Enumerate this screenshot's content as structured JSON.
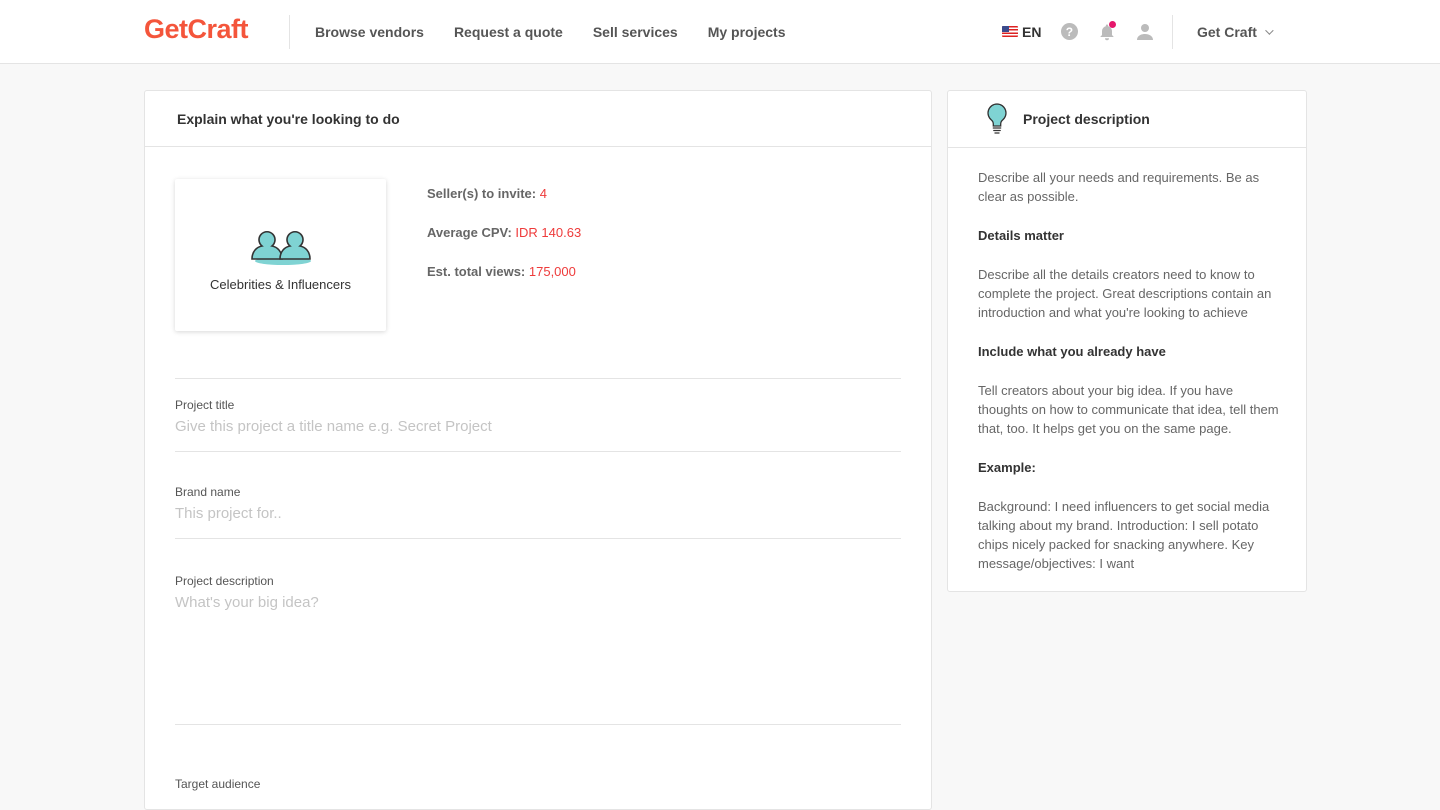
{
  "nav": {
    "logo": "GetCraft",
    "links": [
      "Browse vendors",
      "Request a quote",
      "Sell services",
      "My projects"
    ],
    "language": "EN",
    "account_label": "Get Craft",
    "notification_dot_color": "#e5176b"
  },
  "main": {
    "header": "Explain what you're looking to do",
    "category": "Celebrities & Influencers",
    "stats": [
      {
        "label": "Seller(s) to invite:",
        "value": "4"
      },
      {
        "label": "Average CPV:",
        "value": "IDR 140.63"
      },
      {
        "label": "Est. total views:",
        "value": "175,000"
      }
    ],
    "fields": {
      "title": {
        "label": "Project title",
        "placeholder": "Give this project a title name e.g. Secret Project"
      },
      "brand": {
        "label": "Brand name",
        "placeholder": "This project for.."
      },
      "description": {
        "label": "Project description",
        "placeholder": "What's your big idea?"
      },
      "audience": {
        "label": "Target audience"
      }
    }
  },
  "side": {
    "title": "Project description",
    "intro": "Describe all your needs and requirements. Be as clear as possible.",
    "h1": "Details matter",
    "p1": "Describe all the details creators need to know to complete the project. Great descriptions contain an introduction and what you're looking to achieve",
    "h2": "Include what you already have",
    "p2": "Tell creators about your big idea. If you have thoughts on how to communicate that idea, tell them that, too. It helps get you on the same page.",
    "h3": "Example:",
    "p3": "Background: I need influencers to get social media talking about my brand. Introduction: I sell potato chips nicely packed for snacking anywhere. Key message/objectives: I want"
  },
  "colors": {
    "brand": "#f4553b",
    "accent_value": "#ee3b3b",
    "icon_teal": "#7fd3d3"
  }
}
